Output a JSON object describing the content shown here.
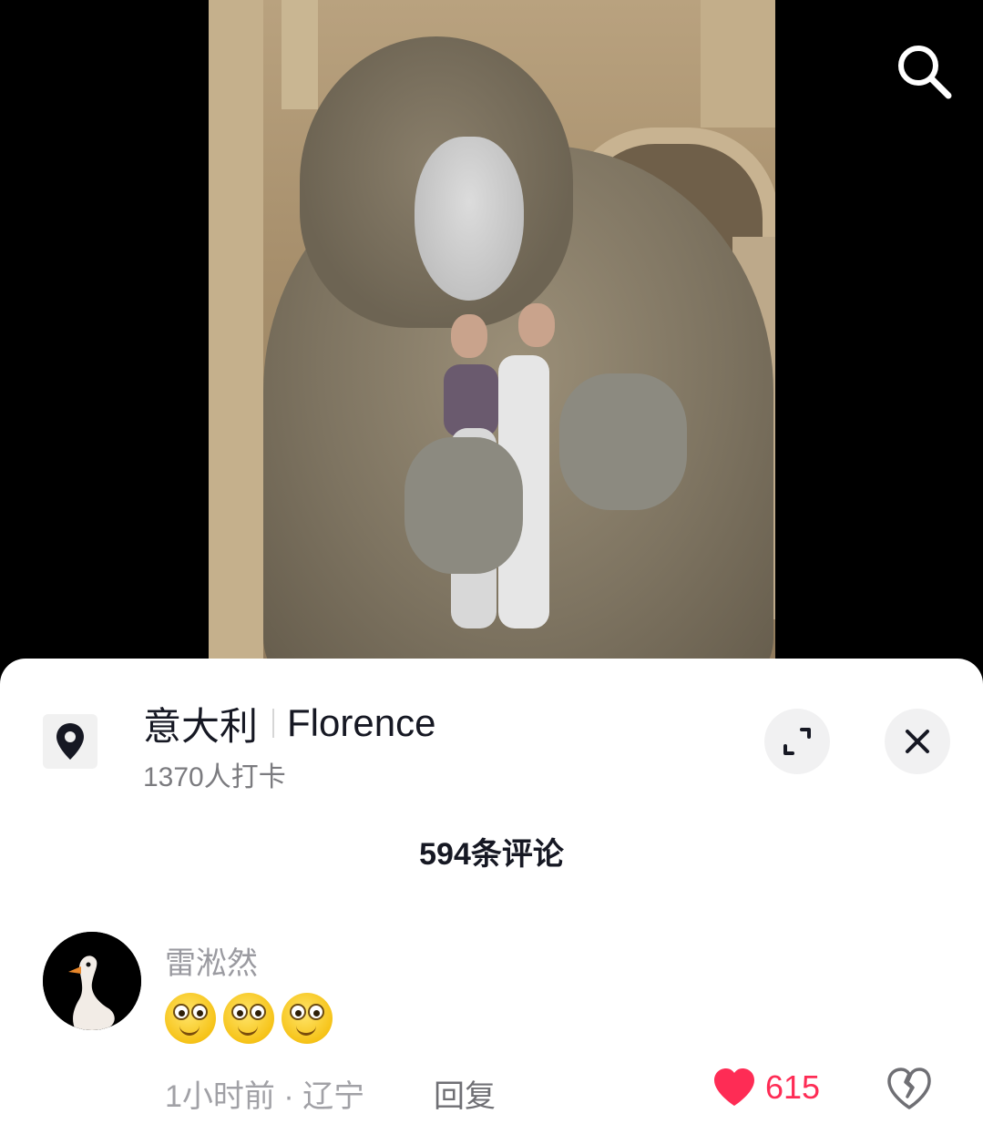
{
  "location": {
    "icon": "location-pin-icon",
    "country": "意大利",
    "city": "Florence",
    "checkins": "1370人打卡"
  },
  "buttons": {
    "search_icon": "search-icon",
    "expand_icon": "expand-icon",
    "close_icon": "close-icon"
  },
  "comments": {
    "count_title": "594条评论",
    "items": [
      {
        "username": "雷淞然",
        "avatar_icon": "goose-avatar",
        "emoji_count": 3,
        "time_location": "1小时前 · 辽宁",
        "reply_label": "回复",
        "likes": "615",
        "like_color": "#fe2c55"
      }
    ]
  }
}
